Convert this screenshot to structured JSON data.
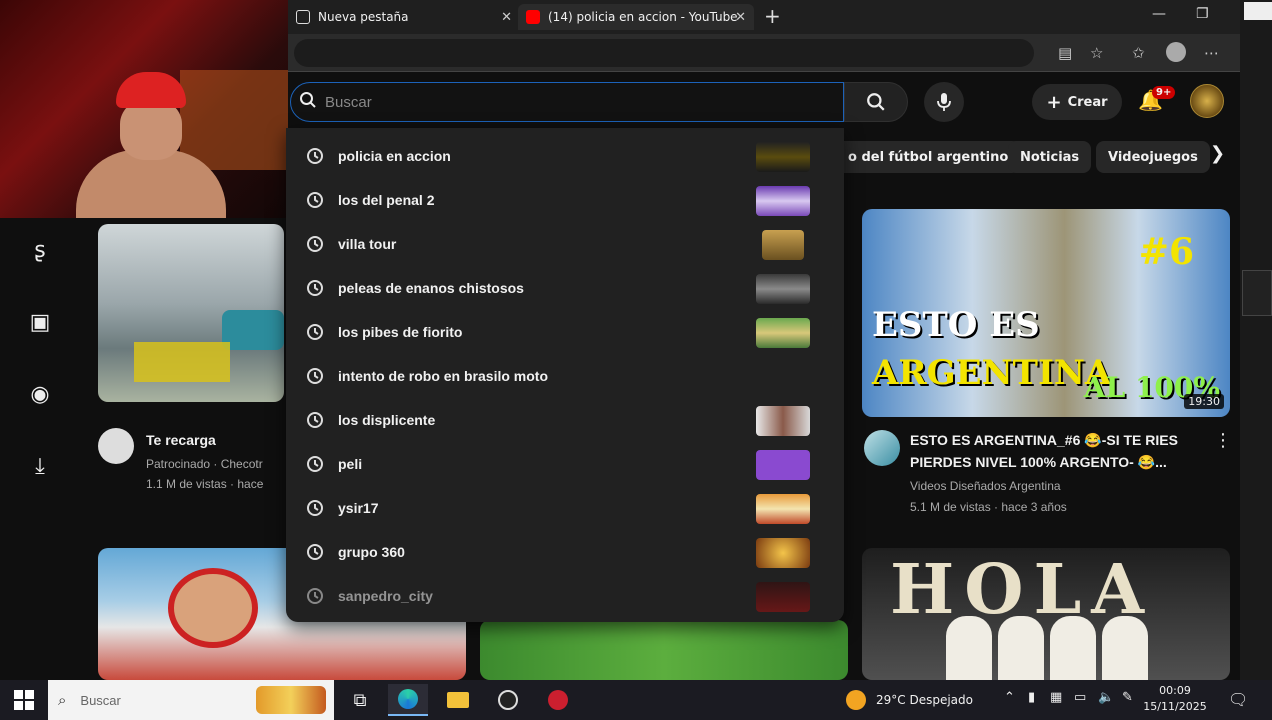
{
  "browser": {
    "tabs": [
      {
        "title": "Nueva pestaña",
        "close": "✕"
      },
      {
        "title": "(14) policia en accion - YouTube",
        "close": "✕"
      }
    ],
    "new_tab": "+",
    "window_controls": [
      "—",
      "❐"
    ]
  },
  "youtube": {
    "search_placeholder": "Buscar",
    "create_label": "Crear",
    "notification_badge": "9+",
    "suggestions": [
      "policia en accion",
      "los del penal 2",
      "villa tour",
      "peleas de enanos chistosos",
      "los pibes de fiorito",
      "intento de robo en brasilo moto",
      "los displicente",
      "peli",
      "ysir17",
      "grupo 360",
      "sanpedro_city"
    ],
    "chips": [
      "o del fútbol argentino",
      "Noticias",
      "Videojuegos"
    ],
    "videos": [
      {
        "title": "Te recarga",
        "channel_line": "Patrocinado · Checotr",
        "meta": "1.1 M de vistas · hace"
      },
      {
        "title_line1": "ESTO ES ARGENTINA_#6 😂-SI TE RIES",
        "title_line2": "PIERDES NIVEL 100% ARGENTO- 😂...",
        "channel": "Videos Diseñados Argentina",
        "meta": "5.1 M de vistas · hace 3 años",
        "thumb_text": {
          "episode": "#6",
          "line1": "ESTO ES",
          "line2": "ARGENTINA",
          "line3": "AL 100%",
          "duration": "19:30"
        }
      },
      {
        "thumb_text": "HOLA"
      }
    ]
  },
  "taskbar": {
    "search_placeholder": "Buscar",
    "weather": "29°C  Despejado",
    "time": "00:09",
    "date": "15/11/2025"
  },
  "colors": {
    "background": "#0f0f0f",
    "dropdown": "#212121",
    "accent_blue": "#1c62b9",
    "badge_red": "#cc0000"
  }
}
